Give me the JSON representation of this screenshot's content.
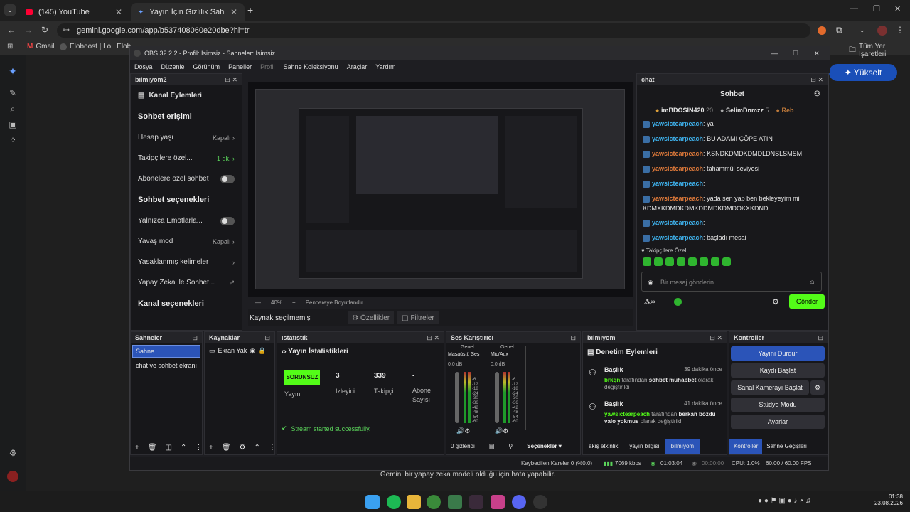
{
  "browser": {
    "tabs": [
      {
        "title": "(145) YouTube"
      },
      {
        "title": "Yayın İçin Gizlilik Sahnesi Öneri"
      }
    ],
    "url": "gemini.google.com/app/b537408060e20dbe?hl=tr",
    "bookmarks": [
      "Gmail",
      "Eloboost | LoL Elob..."
    ],
    "all_bookmarks": "Tüm Yer İşaretleri",
    "upgrade_label": "Yükselt",
    "disclaimer": "Gemini bir yapay zeka modeli olduğu için hata yapabilir."
  },
  "obs": {
    "title": "OBS 32.2.2 - Profil: İsimsiz - Sahneler: İsimsiz",
    "menu": [
      "Dosya",
      "Düzenle",
      "Görünüm",
      "Paneller",
      "Profil",
      "Sahne Koleksiyonu",
      "Araçlar",
      "Yardım"
    ],
    "left_dock": {
      "title": "bılmıyom2",
      "header": "Kanal Eylemleri",
      "section1": "Sohbet erişimi",
      "rows1": [
        {
          "label": "Hesap yaşı",
          "value": "Kapalı"
        },
        {
          "label": "Takipçilere özel...",
          "value": "1 dk."
        },
        {
          "label": "Abonelere özel sohbet",
          "value": ""
        }
      ],
      "section2": "Sohbet seçenekleri",
      "rows2": [
        {
          "label": "Yalnızca Emotlarla...",
          "value": ""
        },
        {
          "label": "Yavaş mod",
          "value": "Kapalı"
        },
        {
          "label": "Yasaklanmış kelimeler",
          "value": ""
        },
        {
          "label": "Yapay Zeka ile Sohbet...",
          "value": ""
        }
      ],
      "section3": "Kanal seçenekleri"
    },
    "preview_bar": {
      "no_source": "Kaynak seçilmemiş",
      "properties": "Özellikler",
      "filters": "Filtreler"
    },
    "chat": {
      "dock_title": "chat",
      "title": "Sohbet",
      "top_users": [
        {
          "name": "imBDOSIN420",
          "count": "20"
        },
        {
          "name": "SelimDnmzz",
          "count": "5"
        },
        {
          "name": "Reb",
          "count": ""
        }
      ],
      "messages": [
        {
          "user": "yawsictearpeach",
          "text": "ya",
          "color": "blue"
        },
        {
          "user": "yawsictearpeach",
          "text": "BU ADAMI ÇÖPE ATIN",
          "color": "blue"
        },
        {
          "user": "yawsictearpeach",
          "text": "KSNDKDMDKDMDLDNSLSMSM",
          "color": "orange"
        },
        {
          "user": "yawsictearpeach",
          "text": "tahammül seviyesi",
          "color": "orange"
        },
        {
          "user": "yawsictearpeach",
          "text": "",
          "color": "blue"
        },
        {
          "user": "yawsictearpeach",
          "text": "yada sen yap ben bekleyeyim mi KDMXKDMDKDMKDDMDKDMDOKXKDND",
          "color": "orange"
        },
        {
          "user": "yawsictearpeach",
          "text": "",
          "color": "blue"
        },
        {
          "user": "yawsictearpeach",
          "text": "başladı mesai",
          "color": "blue"
        }
      ],
      "followers_only": "Takipçilere Özel",
      "input_placeholder": "Bir mesaj gönderin",
      "send": "Gönder"
    },
    "scenes": {
      "title": "Sahneler",
      "items": [
        "Sahne",
        "chat ve sohbet ekranı"
      ]
    },
    "sources": {
      "title": "Kaynaklar",
      "items": [
        "Ekran Yak"
      ]
    },
    "stats": {
      "title": "ıstatıstık",
      "header": "Yayın İstatistikleri",
      "status_badge": "SORUNSUZ",
      "status_label": "Yayın",
      "cells": [
        {
          "value": "3",
          "label": "İzleyici"
        },
        {
          "value": "339",
          "label": "Takipçi"
        },
        {
          "value": "-",
          "label": "Abone Sayısı"
        }
      ],
      "message": "Stream started successfully."
    },
    "mixer": {
      "title": "Ses Karıştırıcı",
      "channels": [
        {
          "label": "Genel",
          "name": "Masaüstü Ses",
          "db": "0.0 dB"
        },
        {
          "label": "Genel",
          "name": "Mic/Aux",
          "db": "0.0 dB"
        }
      ],
      "scale": [
        "-6",
        "-12",
        "-18",
        "-24",
        "-30",
        "-36",
        "-42",
        "-48",
        "-54",
        "-60"
      ],
      "hidden": "0 gizlendi",
      "options": "Seçenekler"
    },
    "mod": {
      "title": "bılmıyom",
      "header": "Denetim Eylemleri",
      "entries": [
        {
          "title": "Başlık",
          "time": "39 dakika önce",
          "user": "brkqn",
          "text1": "tarafından",
          "bold": "sohbet muhabbet",
          "text2": "olarak değiştirildi"
        },
        {
          "title": "Başlık",
          "time": "41 dakika önce",
          "user": "yawsictearpeach",
          "text1": "tarafından",
          "bold": "berkan bozdu valo yokmus",
          "text2": "olarak değiştirildi"
        }
      ],
      "tabs": [
        "akış etkinlik",
        "yayın bilgısı",
        "bılmıyom"
      ]
    },
    "controls": {
      "title": "Kontroller",
      "buttons": [
        "Yayını Durdur",
        "Kaydı Başlat",
        "Sanal Kamerayı Başlat",
        "Stüdyo Modu",
        "Ayarlar"
      ],
      "tabs": [
        "Kontroller",
        "Sahne Geçişleri"
      ]
    },
    "status": {
      "dropped": "Kaybedilen Kareler 0 (%0.0)",
      "bitrate": "7069 kbps",
      "stream_time": "01:03:04",
      "rec_time": "00:00:00",
      "cpu": "CPU: 1.0%",
      "fps": "60.00 / 60.00 FPS"
    },
    "zoom": "40%",
    "fit_window": "Pencereye Boyutlandır"
  },
  "taskbar": {
    "time": "01:38",
    "date": "23.08.2026"
  }
}
